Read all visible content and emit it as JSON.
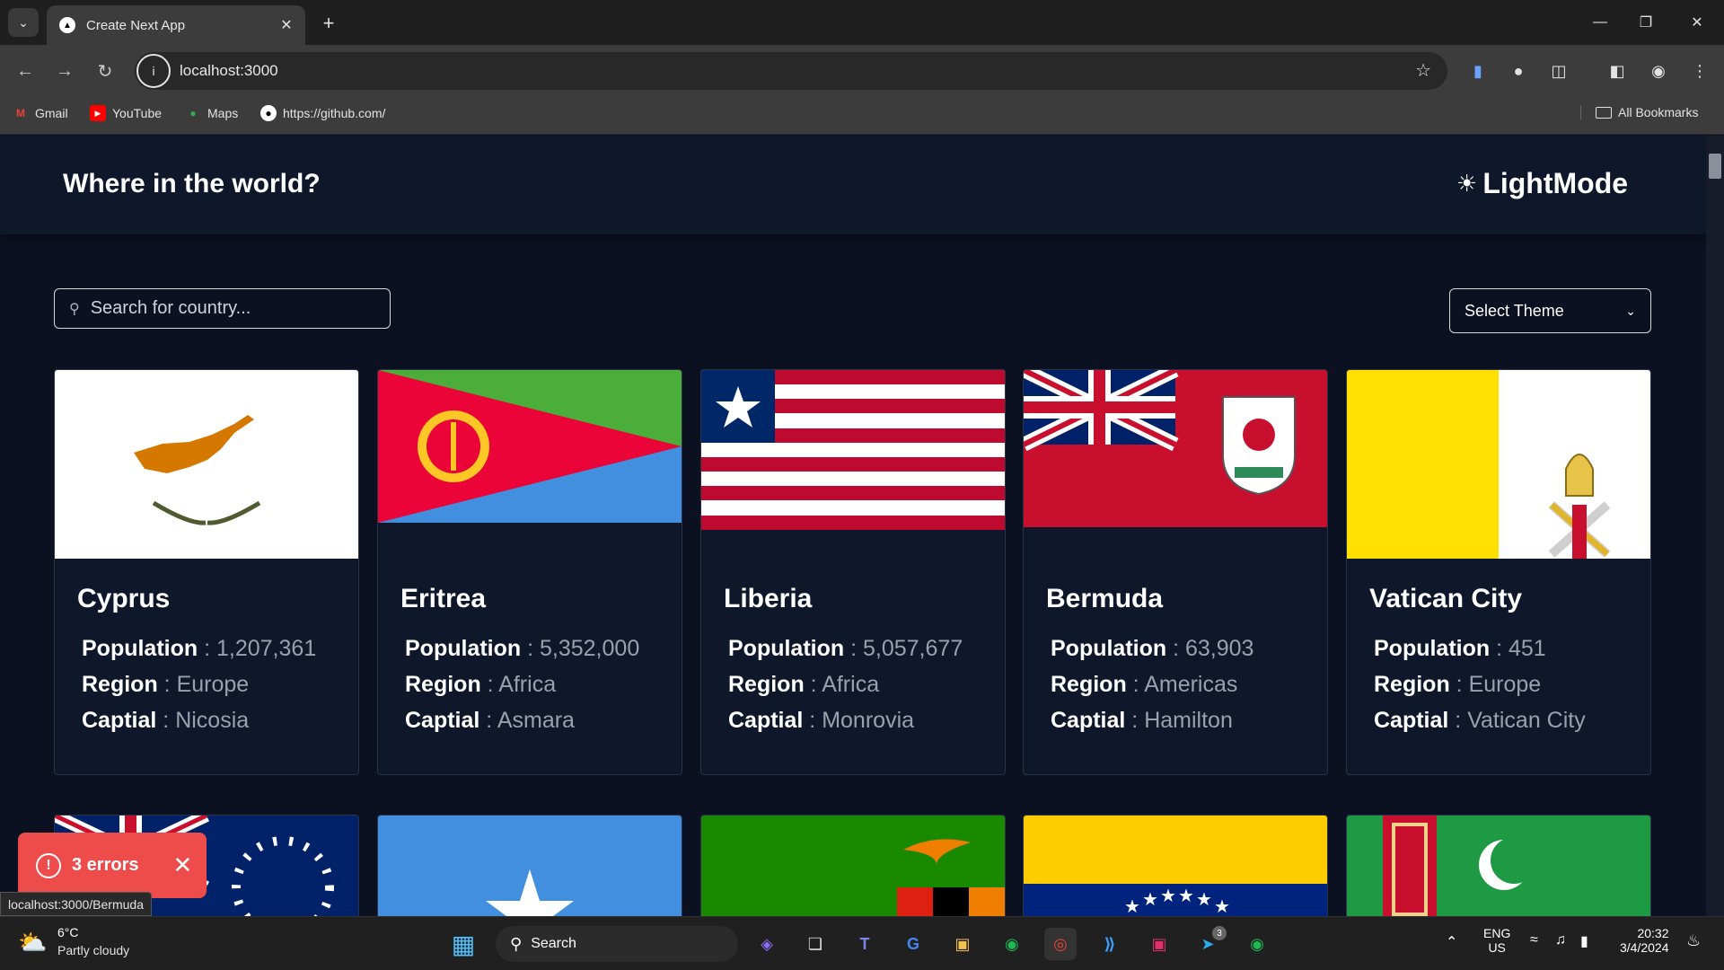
{
  "browser": {
    "tab_title": "Create Next App",
    "url": "localhost:3000",
    "bookmarks": [
      {
        "label": "Gmail",
        "icon": "gmail-icon"
      },
      {
        "label": "YouTube",
        "icon": "youtube-icon"
      },
      {
        "label": "Maps",
        "icon": "maps-icon"
      },
      {
        "label": "https://github.com/",
        "icon": "github-icon"
      }
    ],
    "all_bookmarks": "All Bookmarks",
    "status_url": "localhost:3000/Bermuda"
  },
  "app": {
    "title": "Where in the world?",
    "mode_label": "LightMode",
    "search_placeholder": "Search for country...",
    "theme_select": "Select Theme",
    "labels": {
      "population": "Population",
      "region": "Region",
      "capital": "Captial"
    },
    "countries": [
      {
        "name": "Cyprus",
        "population": "1,207,361",
        "region": "Europe",
        "capital": "Nicosia"
      },
      {
        "name": "Eritrea",
        "population": "5,352,000",
        "region": "Africa",
        "capital": "Asmara"
      },
      {
        "name": "Liberia",
        "population": "5,057,677",
        "region": "Africa",
        "capital": "Monrovia"
      },
      {
        "name": "Bermuda",
        "population": "63,903",
        "region": "Americas",
        "capital": "Hamilton"
      },
      {
        "name": "Vatican City",
        "population": "451",
        "region": "Europe",
        "capital": "Vatican City"
      }
    ],
    "errors_label": "3 errors"
  },
  "taskbar": {
    "temperature": "6°C",
    "weather": "Partly cloudy",
    "search_label": "Search",
    "lang_line1": "ENG",
    "lang_line2": "US",
    "time": "20:32",
    "date": "3/4/2024",
    "telegram_badge": "3"
  },
  "colors": {
    "page_bg": "#0b1120",
    "header_bg": "#0f172a",
    "error": "#ee4b4b",
    "muted_value": "#9aa1ad"
  }
}
